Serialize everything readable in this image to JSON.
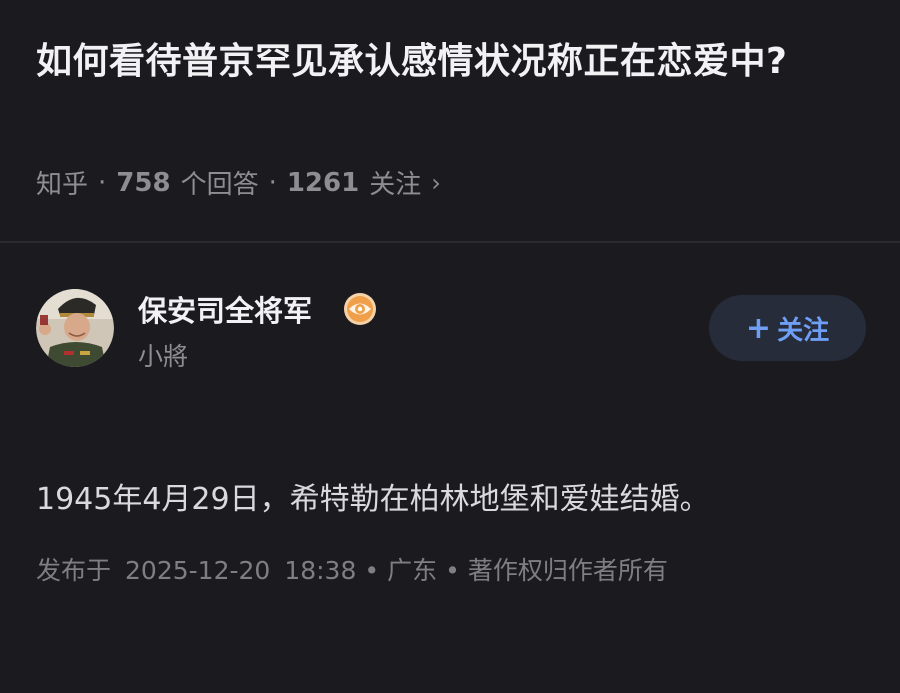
{
  "question": {
    "title": "如何看待普京罕见承认感情状况称正在恋爱中?",
    "source": "知乎",
    "separator": "·",
    "answer_count": "758",
    "answer_label": "个回答",
    "follower_count": "1261",
    "follower_label": "关注",
    "chevron": "›"
  },
  "author": {
    "name": "保安司全将军",
    "headline": "小將",
    "badge_icon": "eye-badge-icon",
    "avatar_icon": "avatar-photo"
  },
  "follow_button": {
    "plus": "+",
    "label": "关注"
  },
  "answer": {
    "text": "1945年4月29日，希特勒在柏林地堡和爱娃结婚。",
    "published_label": "发布于",
    "date": "2025-12-20",
    "time": "18:38",
    "location": "广东",
    "copyright": "著作权归作者所有",
    "dot": "•"
  },
  "colors": {
    "background": "#1b1b1f",
    "title": "#f2f2f4",
    "muted": "#8d8d93",
    "accent": "#6f9ef5",
    "button_bg": "#262c3a",
    "badge": "#f0a04b"
  }
}
